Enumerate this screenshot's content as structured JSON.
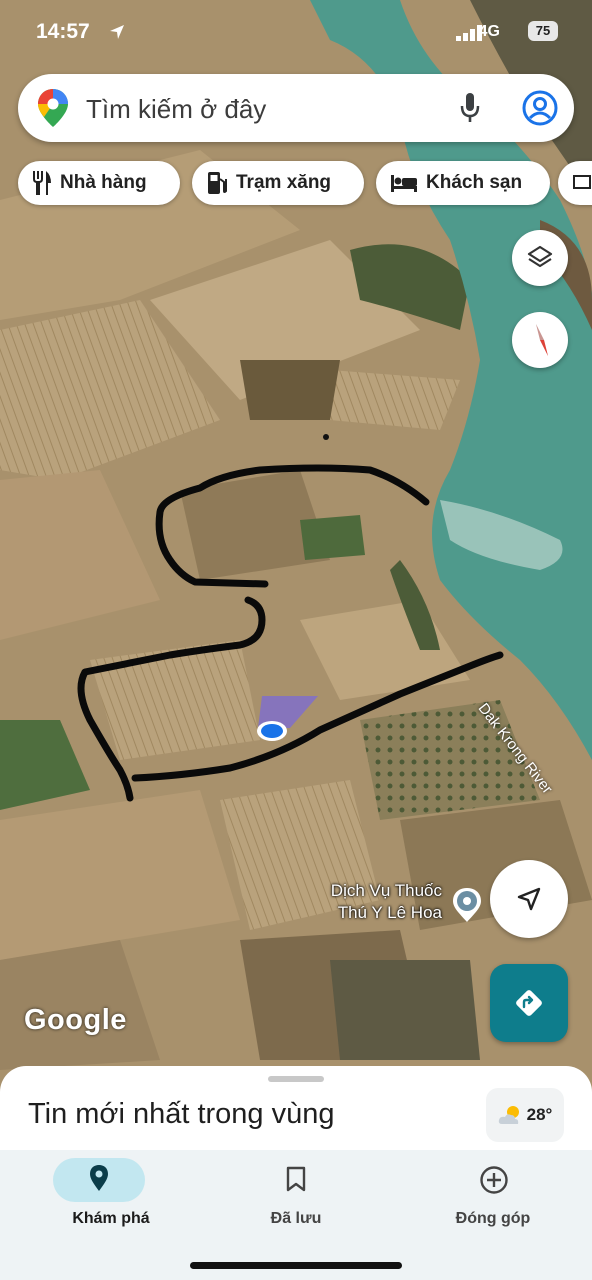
{
  "status_bar": {
    "time": "14:57",
    "network": "4G",
    "battery": "75"
  },
  "search": {
    "placeholder": "Tìm kiếm ở đây"
  },
  "chips": [
    {
      "label": "Nhà hàng",
      "icon": "restaurant-icon"
    },
    {
      "label": "Trạm xăng",
      "icon": "gas-station-icon"
    },
    {
      "label": "Khách sạn",
      "icon": "hotel-icon"
    }
  ],
  "map": {
    "attribution": "Google",
    "place_label": [
      "Dịch Vụ Thuốc",
      "Thú Y Lê Hoa"
    ],
    "river_label": "Dak Krong River"
  },
  "sheet": {
    "title": "Tin mới nhất trong vùng"
  },
  "weather": {
    "temp": "28°"
  },
  "nav": [
    {
      "label": "Khám phá",
      "icon": "explore-pin-icon",
      "active": true
    },
    {
      "label": "Đã lưu",
      "icon": "bookmark-icon",
      "active": false
    },
    {
      "label": "Đóng góp",
      "icon": "add-circle-icon",
      "active": false
    }
  ],
  "colors": {
    "accent": "#0e7d8c",
    "river": "#4f9a8c",
    "active_pill": "#c2e7f0"
  }
}
